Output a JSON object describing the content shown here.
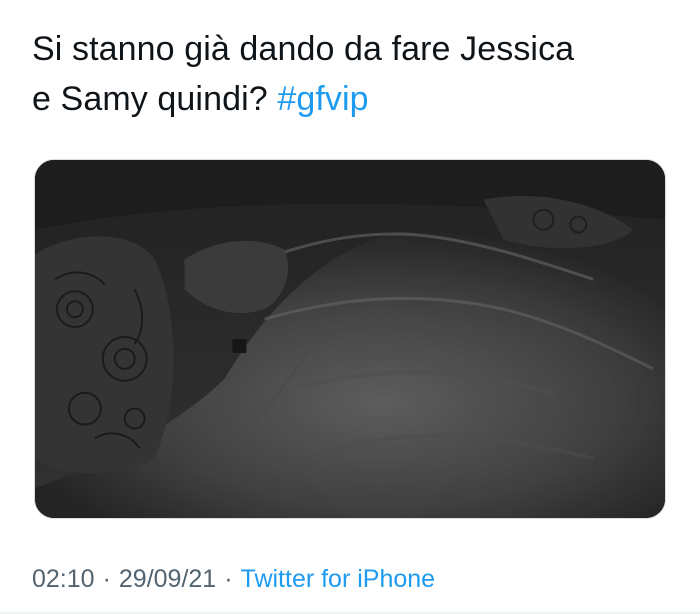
{
  "tweet": {
    "text_line1": "Si stanno già dando da fare Jessica",
    "text_line2": "e Samy quindi?",
    "hashtag": "#gfvip"
  },
  "media": {
    "description_icon": "photo-icon"
  },
  "meta": {
    "time": "02:10",
    "separator1": "·",
    "date": "29/09/21",
    "separator2": "·",
    "source": "Twitter for iPhone"
  },
  "colors": {
    "text": "#0f1419",
    "link": "#1d9bf0",
    "secondary": "#536471",
    "media_bg": "#2f2f2f"
  }
}
